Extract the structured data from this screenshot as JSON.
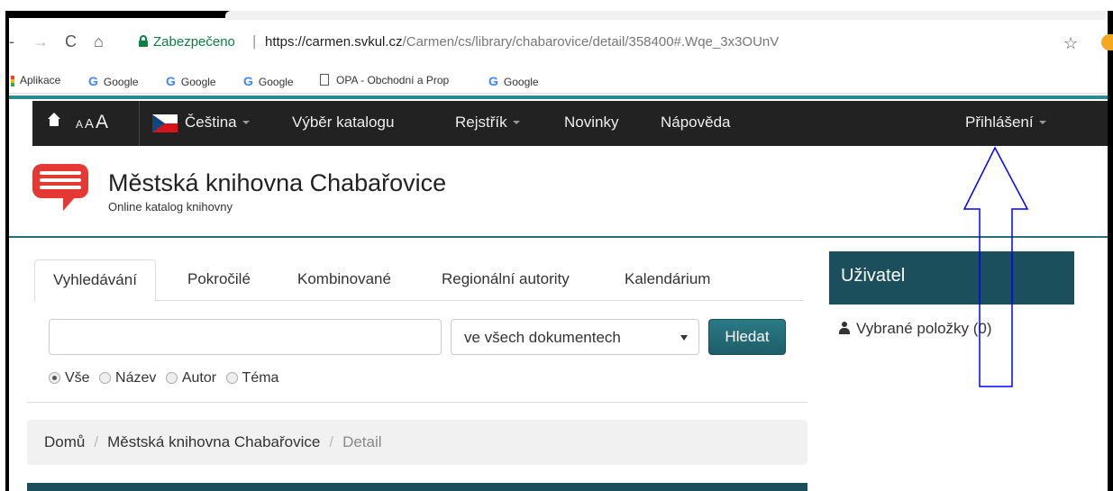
{
  "browser": {
    "secure_label": "Zabezpečeno",
    "url_host": "https://carmen.svkul.cz",
    "url_path": "/Carmen/cs/library/chabarovice/detail/358400#.Wqe_3x3OUnV",
    "bookmarks": [
      {
        "label": "Aplikace",
        "icon": "apps-icon"
      },
      {
        "label": "Google",
        "icon": "google-icon"
      },
      {
        "label": "Google",
        "icon": "google-icon"
      },
      {
        "label": "Google",
        "icon": "google-icon"
      },
      {
        "label": "OPA - Obchodní a Prop",
        "icon": "document-icon"
      },
      {
        "label": "Google",
        "icon": "google-icon"
      }
    ]
  },
  "navbar": {
    "font_sizes": [
      "A",
      "A",
      "A"
    ],
    "language": "Čeština",
    "catalog": "Výběr katalogu",
    "register": "Rejstřík",
    "news": "Novinky",
    "help": "Nápověda",
    "login": "Přihlášení"
  },
  "header": {
    "title": "Městská knihovna Chabařovice",
    "subtitle": "Online katalog knihovny"
  },
  "search": {
    "tabs": [
      "Vyhledávání",
      "Pokročilé",
      "Kombinované",
      "Regionální autority",
      "Kalendárium"
    ],
    "active_tab": "Vyhledávání",
    "input_value": "",
    "scope": "ve všech dokumentech",
    "button": "Hledat",
    "radios": [
      "Vše",
      "Název",
      "Autor",
      "Téma"
    ],
    "radio_selected": "Vše"
  },
  "breadcrumb": {
    "home": "Domů",
    "library": "Městská knihovna Chabařovice",
    "current": "Detail",
    "separator": "/"
  },
  "user_panel": {
    "title": "Uživatel",
    "selected_items": "Vybrané položky (0)"
  },
  "colors": {
    "navbar_bg": "#222222",
    "accent_teal": "#1a4f5b",
    "logo_red": "#e53935",
    "secure_green": "#0b8043",
    "annotation_arrow": "#0000ff"
  }
}
